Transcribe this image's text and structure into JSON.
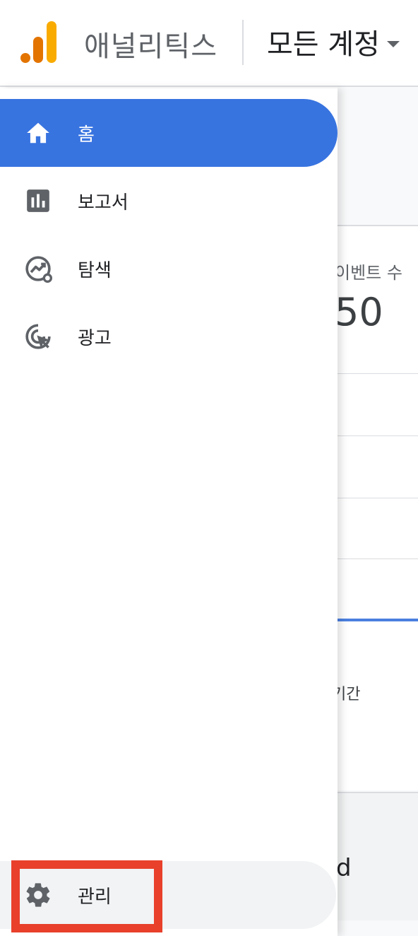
{
  "header": {
    "app_name": "애널리틱스",
    "account_selector": "모든 계정"
  },
  "background": {
    "metric_label": "이벤트 수",
    "metric_value": "50",
    "period_label": "기간",
    "bottom_text": "d"
  },
  "nav": {
    "items": [
      {
        "label": "홈",
        "icon": "home-icon",
        "active": true
      },
      {
        "label": "보고서",
        "icon": "reports-icon",
        "active": false
      },
      {
        "label": "탐색",
        "icon": "explore-icon",
        "active": false
      },
      {
        "label": "광고",
        "icon": "advertising-icon",
        "active": false
      }
    ],
    "admin": {
      "label": "관리",
      "icon": "gear-icon"
    }
  },
  "colors": {
    "active_nav": "#3874e0",
    "highlight": "#e8402b",
    "logo_dark": "#e37400",
    "logo_light": "#f9ab00"
  }
}
